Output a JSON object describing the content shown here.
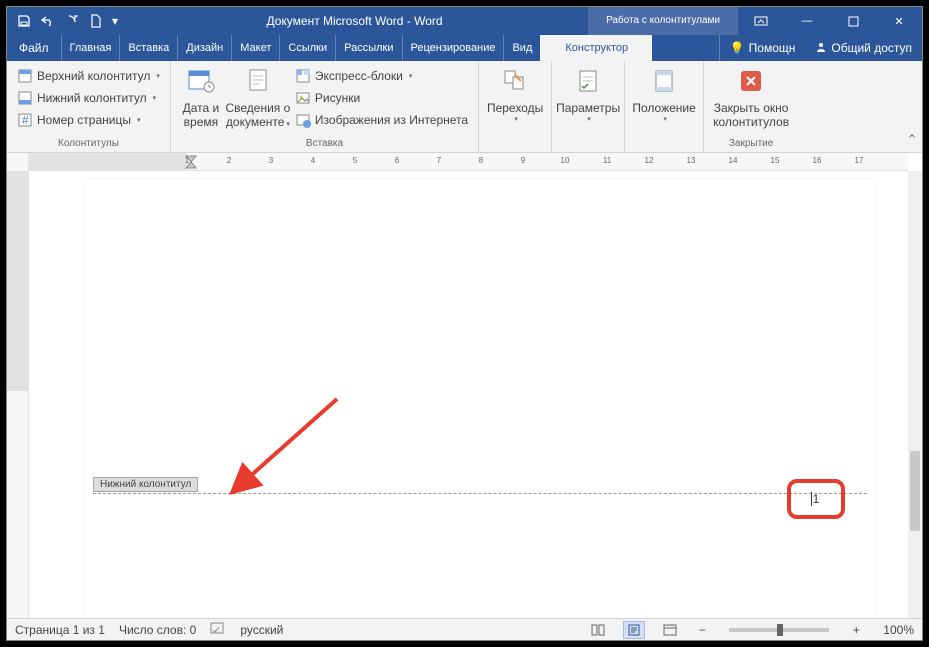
{
  "title": "Документ Microsoft Word - Word",
  "toolTabGroup": "Работа с колонтитулами",
  "tabs": {
    "file": "Файл",
    "home": "Главная",
    "insert": "Вставка",
    "design": "Дизайн",
    "layout": "Макет",
    "references": "Ссылки",
    "mailings": "Рассылки",
    "review": "Рецензирование",
    "view": "Вид",
    "constructor": "Конструктор"
  },
  "help": "Помощн",
  "share": "Общий доступ",
  "ribbon": {
    "g1": {
      "label": "Колонтитулы",
      "header": "Верхний колонтитул",
      "footer": "Нижний колонтитул",
      "pagenum": "Номер страницы"
    },
    "g2": {
      "label": "Вставка",
      "datetime1": "Дата и",
      "datetime2": "время",
      "docinfo1": "Сведения о",
      "docinfo2": "документе",
      "quickparts": "Экспресс-блоки",
      "pictures": "Рисунки",
      "onlinepics": "Изображения из Интернета"
    },
    "g3": {
      "nav": "Переходы"
    },
    "g4": {
      "options": "Параметры"
    },
    "g5": {
      "position": "Положение"
    },
    "g6": {
      "label": "Закрытие",
      "close1": "Закрыть окно",
      "close2": "колонтитулов"
    }
  },
  "page": {
    "footerTag": "Нижний колонтитул",
    "pageNumber": "1"
  },
  "status": {
    "page": "Страница 1 из 1",
    "words": "Число слов: 0",
    "lang": "русский",
    "zoom": "100%"
  }
}
